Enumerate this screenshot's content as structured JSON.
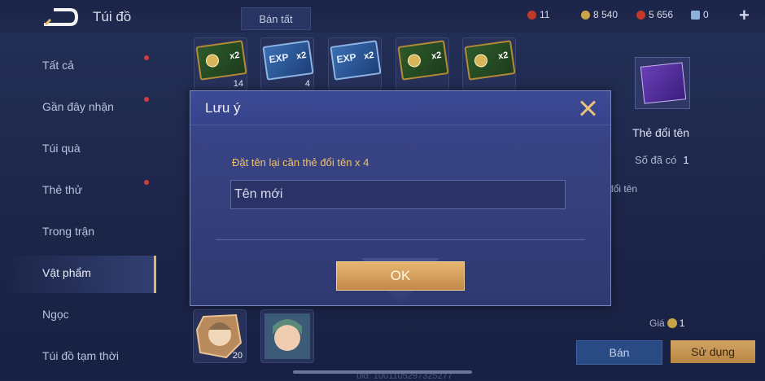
{
  "header": {
    "title": "Túi đồ",
    "sell_all_label": "Bán tất",
    "currencies": [
      {
        "name": "ruby",
        "value": "11",
        "color": "#c0392b"
      },
      {
        "name": "gold",
        "value": "8 540",
        "color": "#c9a548"
      },
      {
        "name": "voucher",
        "value": "5 656",
        "color": "#c0392b"
      },
      {
        "name": "diamond",
        "value": "0",
        "color": "#8fb0d9"
      }
    ],
    "plus_label": "+"
  },
  "sidebar": {
    "items": [
      {
        "label": "Tất cả",
        "badge": true
      },
      {
        "label": "Gần đây nhận",
        "badge": true
      },
      {
        "label": "Túi quà",
        "badge": false
      },
      {
        "label": "Thẻ thử",
        "badge": true
      },
      {
        "label": "Trong trận",
        "badge": false
      },
      {
        "label": "Vật phẩm",
        "badge": false,
        "active": true
      },
      {
        "label": "Ngọc",
        "badge": false
      },
      {
        "label": "Túi đồ tạm thời",
        "badge": false
      }
    ]
  },
  "items": {
    "row1": [
      {
        "kind": "gold-card",
        "label": "x2",
        "count": "14"
      },
      {
        "kind": "exp-card",
        "label": "EXP",
        "mult": "x2",
        "count": "4"
      },
      {
        "kind": "exp-card",
        "label": "EXP",
        "mult": "x2",
        "count": ""
      },
      {
        "kind": "gold-card",
        "label": "x2",
        "count": ""
      },
      {
        "kind": "gold-card",
        "label": "x2",
        "count": ""
      }
    ],
    "row_bottom": [
      {
        "kind": "hero-portrait",
        "count": "20"
      },
      {
        "kind": "hero-portrait",
        "count": ""
      }
    ]
  },
  "detail": {
    "name": "Thẻ đổi tên",
    "owned_label": "Số đã có",
    "owned_value": "1",
    "desc_partial": "đổi tên",
    "price_label": "Giá",
    "price_value": "1",
    "sell_label": "Bán",
    "use_label": "Sử dụng"
  },
  "footer": {
    "uid": "uid: 1001105297325277"
  },
  "modal": {
    "title": "Lưu ý",
    "message": "Đặt tên lại cần thẻ đổi tên x 4",
    "input_value": "Tên mới",
    "ok_label": "OK"
  }
}
